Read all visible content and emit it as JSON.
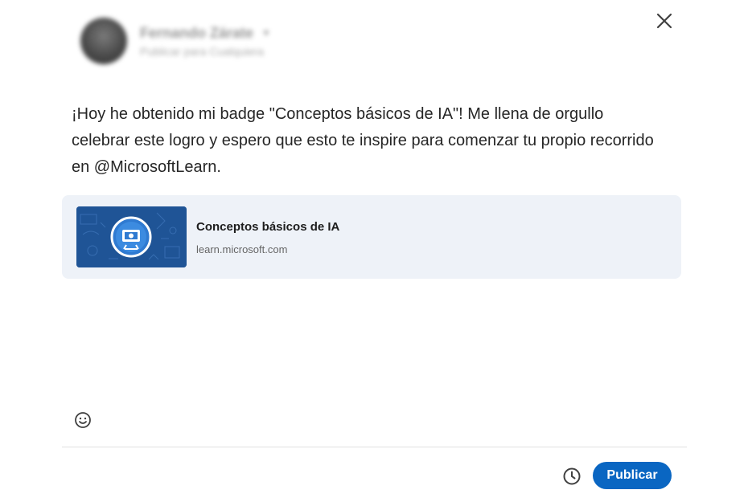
{
  "header": {
    "user_name": "Fernando Zárate",
    "visibility": "Publicar para Cualquiera"
  },
  "post": {
    "text": "¡Hoy he obtenido mi badge \"Conceptos básicos de IA\"! Me llena de orgullo celebrar este logro y espero que esto te inspire para comenzar tu propio recorrido en @MicrosoftLearn."
  },
  "link_card": {
    "title": "Conceptos básicos de IA",
    "domain": "learn.microsoft.com"
  },
  "footer": {
    "publish_label": "Publicar"
  },
  "colors": {
    "accent": "#0a66c2",
    "card_background": "#eef2f8",
    "thumbnail_background": "#1f5496"
  },
  "icons": {
    "close": "close-icon",
    "emoji": "emoji-icon",
    "schedule": "clock-icon",
    "chevron": "chevron-down-icon"
  }
}
